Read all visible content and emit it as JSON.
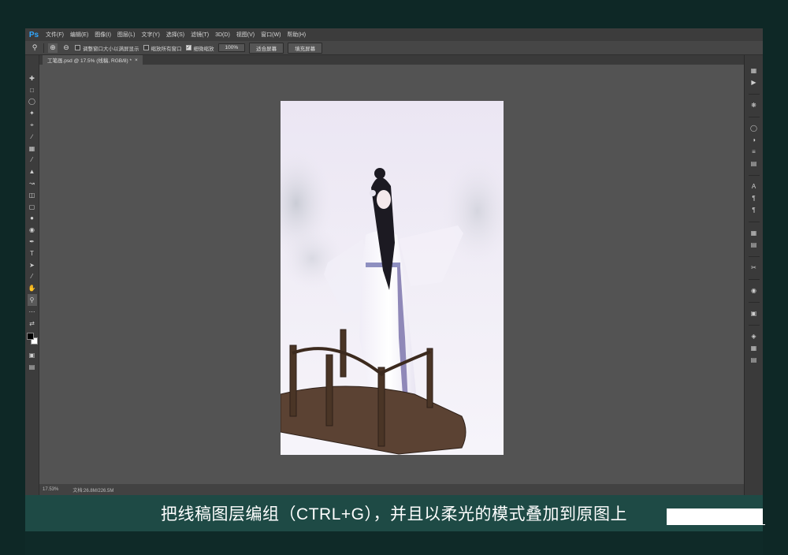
{
  "app": {
    "logo": "Ps"
  },
  "menu": [
    "文件(F)",
    "编辑(E)",
    "图像(I)",
    "图层(L)",
    "文字(Y)",
    "选择(S)",
    "滤镜(T)",
    "3D(D)",
    "视图(V)",
    "窗口(W)",
    "帮助(H)"
  ],
  "options": {
    "check1_label": "调整窗口大小以满屏显示",
    "check1_checked": false,
    "check2_label": "缩放所有窗口",
    "check2_checked": false,
    "check3_label": "细微缩放",
    "check3_checked": true,
    "zoom_value": "100%",
    "fit_button": "适合屏幕",
    "fill_button": "填充屏幕"
  },
  "document_tab": {
    "title": "工笔画.psd @ 17.5% (线稿, RGB/8) *",
    "close": "×"
  },
  "status": {
    "zoom": "17.53%",
    "doc_size": "文档:26.8M/226.5M"
  },
  "caption": "把线稿图层编组（CTRL+G），并且以柔光的模式叠加到原图上",
  "icons": {
    "left_tools": [
      "move-icon",
      "marquee-icon",
      "lasso-icon",
      "magic-wand-icon",
      "crop-icon",
      "eyedropper-icon",
      "healing-icon",
      "brush-icon",
      "stamp-icon",
      "history-brush-icon",
      "eraser-icon",
      "gradient-icon",
      "blur-icon",
      "dodge-icon",
      "pen-icon",
      "type-icon",
      "path-select-icon",
      "line-icon",
      "hand-icon",
      "zoom-icon",
      "more-icon",
      "swap-colors-icon"
    ],
    "right_panels": [
      "history-icon",
      "play-icon",
      "color-icon",
      "swatches-icon",
      "adjustments-icon",
      "styles-icon",
      "properties-icon",
      "character-icon",
      "paragraph-icon",
      "glyphs-icon",
      "layers-icon",
      "channels-icon",
      "paths-icon",
      "tools-icon",
      "libraries-icon",
      "brushes-icon",
      "grid-icon"
    ]
  },
  "colors": {
    "foreground": "#000000",
    "background": "#ffffff",
    "caption_bar": "#1e4a45",
    "frame": "#0e2826"
  }
}
